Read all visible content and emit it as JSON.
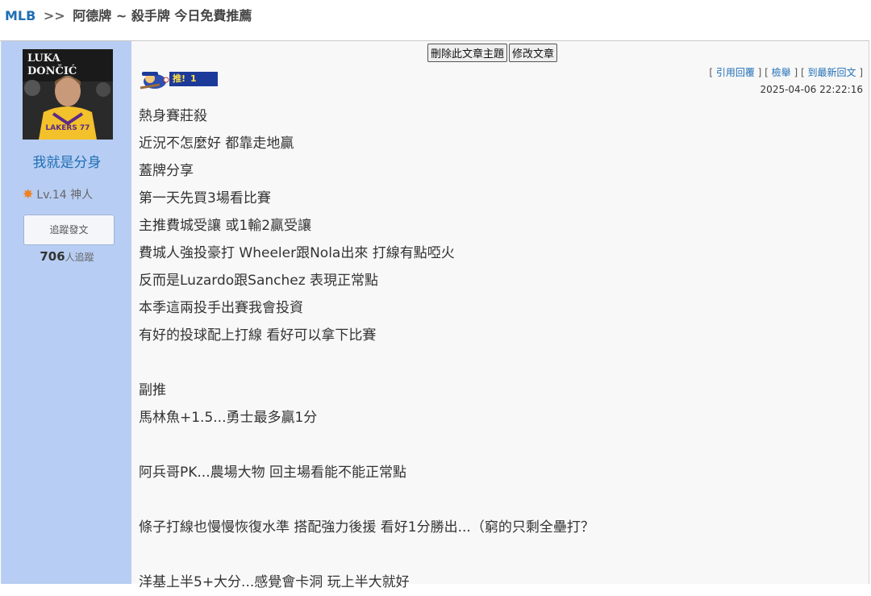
{
  "breadcrumb": {
    "root": "MLB",
    "separator": ">>",
    "title": "阿德牌 ~ 殺手牌 今日免費推薦"
  },
  "user": {
    "avatar_text": "LUKA DONČIĆ",
    "avatar_jersey": "LAKERS 77",
    "name": "我就是分身",
    "level": "Lv.14 神人",
    "follow_button": "追蹤發文",
    "followers_count": "706",
    "followers_label": "人追蹤"
  },
  "toolbar": {
    "delete_label": "刪除此文章主題",
    "edit_label": "修改文章"
  },
  "push": {
    "label": "推!",
    "count": "1"
  },
  "actions": {
    "open1": "[ ",
    "quote": "引用回覆",
    "mid1": " ] [ ",
    "report": "檢舉",
    "mid2": " ] [ ",
    "latest": "到最新回文",
    "close": " ]"
  },
  "post_time": "2025-04-06 22:22:16",
  "content_lines": [
    "熱身賽莊殺",
    "近況不怎麼好 都靠走地贏",
    "蓋牌分享",
    "第一天先買3場看比賽",
    "主推費城受讓 或1輸2贏受讓",
    "費城人強投豪打 Wheeler跟Nola出來 打線有點啞火",
    "反而是Luzardo跟Sanchez 表現正常點",
    "本季這兩投手出賽我會投資",
    "有好的投球配上打線 看好可以拿下比賽",
    "",
    "副推",
    "馬林魚+1.5...勇士最多贏1分",
    "",
    "阿兵哥PK...農場大物 回主場看能不能正常點",
    "",
    "條子打線也慢慢恢復水準 搭配強力後援 看好1分勝出...（窮的只剩全壘打？",
    "",
    "洋基上半5+大分...感覺會卡洞 玩上半大就好"
  ],
  "colors": {
    "sidebar": "#b7cdf3",
    "link": "#1f6fb5",
    "push_tag": "#1c3a9a"
  }
}
